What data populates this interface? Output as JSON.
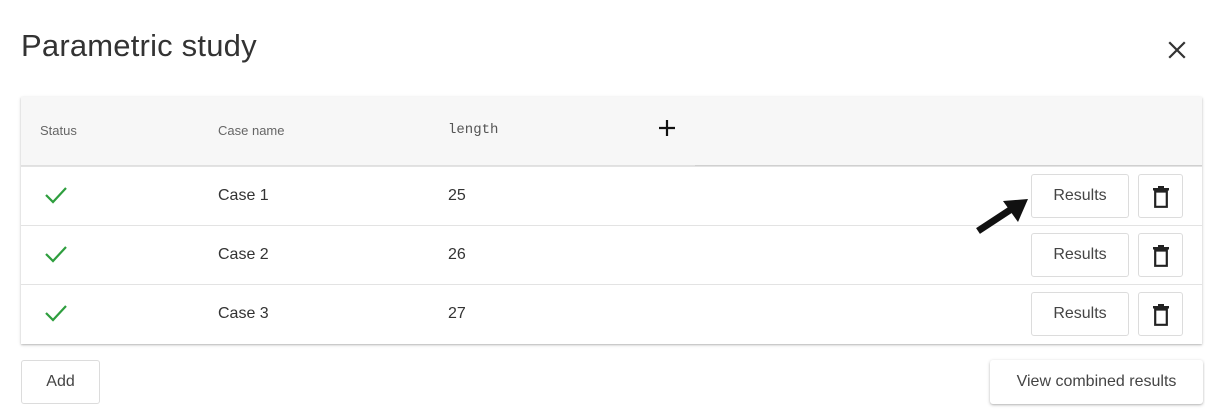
{
  "dialog": {
    "title": "Parametric study"
  },
  "table": {
    "headers": {
      "status": "Status",
      "case_name": "Case name",
      "param": "length"
    },
    "rows": [
      {
        "status": "success",
        "case_name": "Case 1",
        "length": "25",
        "results_label": "Results"
      },
      {
        "status": "success",
        "case_name": "Case 2",
        "length": "26",
        "results_label": "Results"
      },
      {
        "status": "success",
        "case_name": "Case 3",
        "length": "27",
        "results_label": "Results"
      }
    ]
  },
  "footer": {
    "add_label": "Add",
    "combined_label": "View combined results"
  },
  "colors": {
    "success": "#2e9e3e",
    "header_bg": "#f7f7f7",
    "text": "#333333"
  },
  "icons": {
    "close": "close-icon",
    "add_column": "plus-icon",
    "status": "checkmark-icon",
    "delete": "trash-icon",
    "pointer": "arrow-annotation-icon"
  }
}
